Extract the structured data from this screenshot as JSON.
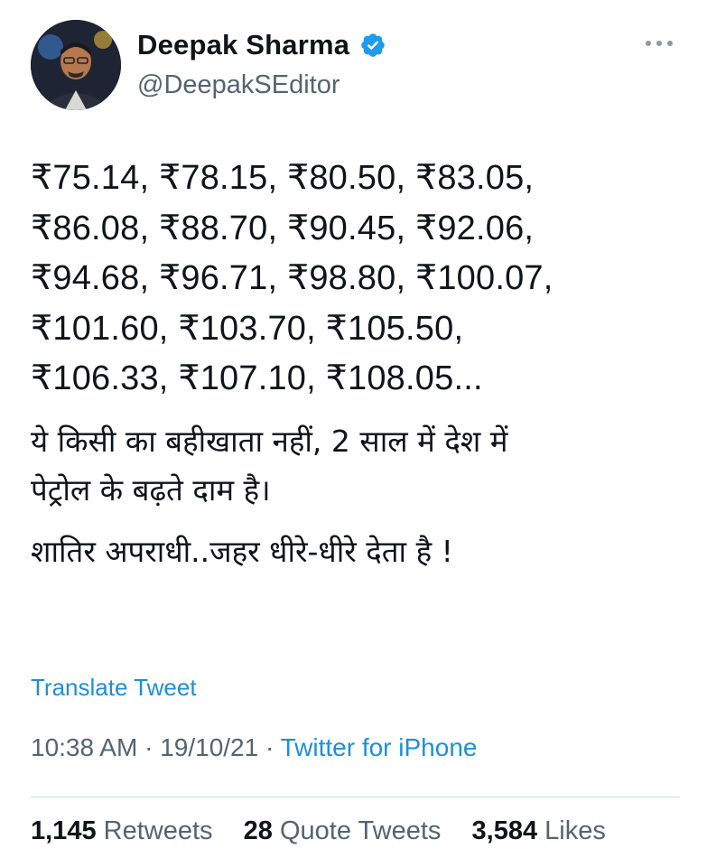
{
  "author": {
    "display_name": "Deepak Sharma",
    "handle": "@DeepakSEditor",
    "verified": true
  },
  "tweet": {
    "price_lines": [
      "₹75.14, ₹78.15, ₹80.50, ₹83.05,",
      "₹86.08, ₹88.70, ₹90.45, ₹92.06,",
      "₹94.68, ₹96.71, ₹98.80, ₹100.07,",
      "₹101.60, ₹103.70, ₹105.50,",
      "₹106.33, ₹107.10, ₹108.05..."
    ],
    "hindi_para1_lines": [
      "ये किसी का बहीखाता नहीं, 2 साल में देश में",
      "पेट्रोल के बढ़ते दाम है।"
    ],
    "hindi_para2": "शातिर अपराधी..जहर धीरे-धीरे देता है !"
  },
  "translate_label": "Translate Tweet",
  "meta": {
    "time": "10:38 AM",
    "separator": "·",
    "date": "19/10/21",
    "source": "Twitter for iPhone"
  },
  "stats": {
    "retweets_count": "1,145",
    "retweets_label": "Retweets",
    "quotes_count": "28",
    "quotes_label": "Quote Tweets",
    "likes_count": "3,584",
    "likes_label": "Likes"
  },
  "colors": {
    "accent": "#1d9bf0",
    "secondary_text": "#536471",
    "primary_text": "#0f1419"
  },
  "icons": [
    "verified-badge-icon",
    "more-options-icon"
  ]
}
